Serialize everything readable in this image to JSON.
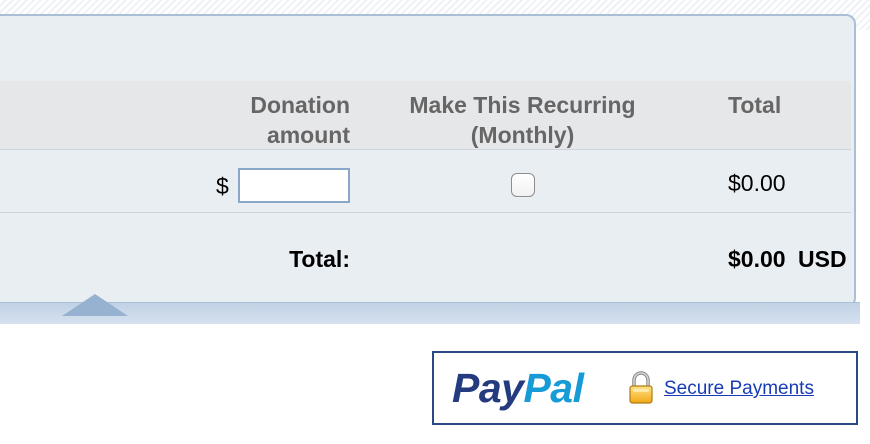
{
  "table": {
    "headers": {
      "donation_line1": "Donation",
      "donation_line2": "amount",
      "recurring_line1": "Make This Recurring",
      "recurring_line2": "(Monthly)",
      "total": "Total"
    },
    "row": {
      "currency_symbol": "$",
      "amount_value": "",
      "recurring_checked": false,
      "total": "$0.00"
    },
    "footer": {
      "total_label": "Total:",
      "total_value": "$0.00",
      "currency": "USD"
    }
  },
  "paypal": {
    "logo_pay": "Pay",
    "logo_pal": "Pal",
    "lock_icon": "padlock-icon",
    "link_text": "Secure Payments"
  },
  "colors": {
    "panel_bg": "#e9eef3",
    "panel_border": "#a9bfd6",
    "header_text": "#666666",
    "paypal_dark": "#253b80",
    "paypal_light": "#179bd7",
    "link": "#1a3bb8"
  }
}
